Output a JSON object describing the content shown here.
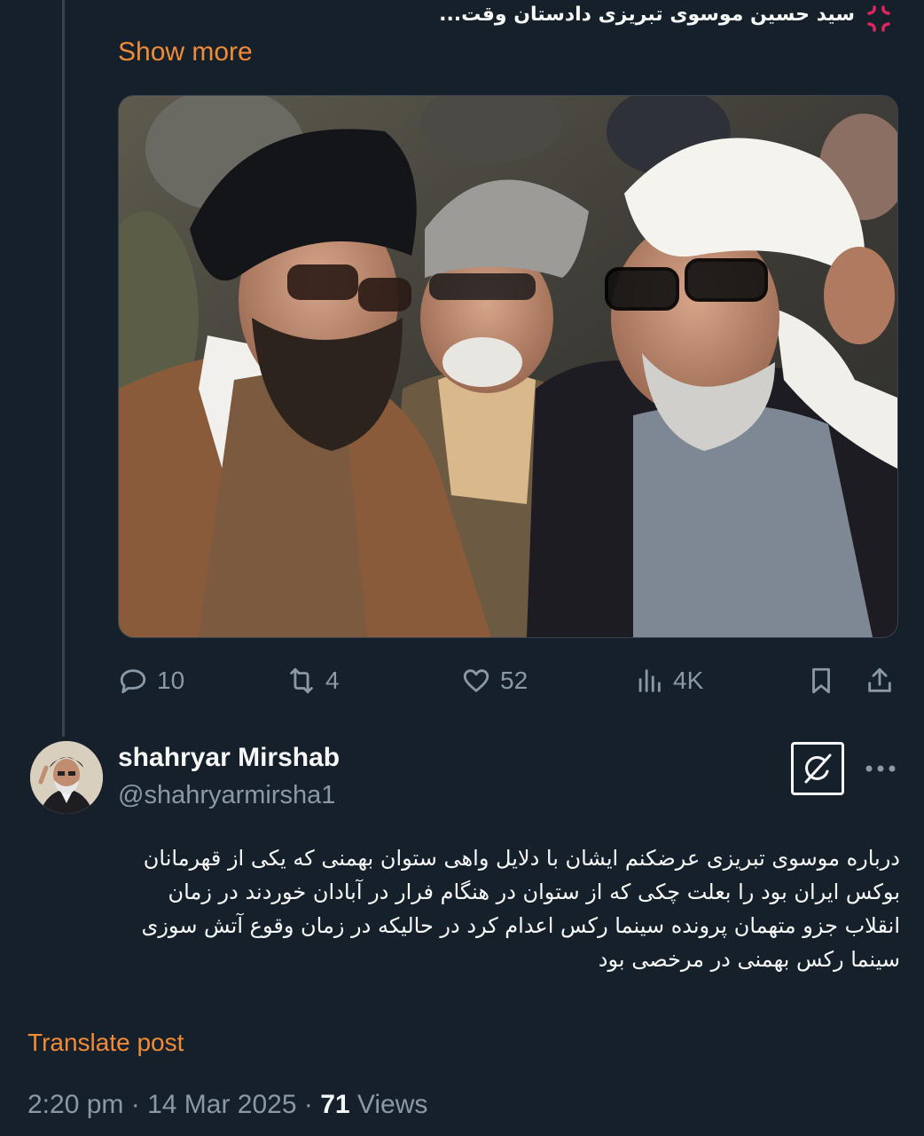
{
  "colors": {
    "background": "#15202b",
    "text": "#f7f9f9",
    "muted": "#8b98a5",
    "accent": "#f18b38",
    "border": "#38444d"
  },
  "prev_post": {
    "text_line": "سید حسین موسوی تبریزی دادستان وقت...",
    "emoji": "anger-symbol-icon",
    "show_more_label": "Show more"
  },
  "actions": {
    "replies": "10",
    "reposts": "4",
    "likes": "52",
    "views": "4K",
    "icons": [
      "reply-icon",
      "repost-icon",
      "like-icon",
      "views-icon",
      "bookmark-icon",
      "share-icon"
    ]
  },
  "post": {
    "author_name": "shahryar Mirshab",
    "author_handle": "@shahryarmirsha1",
    "text_lines": [
      "درباره موسوی تبریزی عرضکنم  ایشان با دلایل واهی ستوان بهمنی که یکی از قهرمانان",
      "بوکس ایران بود را بعلت چکی که از ستوان در هنگام فرار در آبادان خوردند در زمان",
      "انقلاب جزو متهمان پرونده سینما رکس اعدام کرد در حالیکه در زمان وقوع آتش سوزی",
      "سینما رکس بهمنی در مرخصی بود"
    ],
    "translate_label": "Translate post",
    "time": "2:20 pm",
    "date": "14 Mar 2025",
    "views_count": "71",
    "views_label": "Views"
  }
}
